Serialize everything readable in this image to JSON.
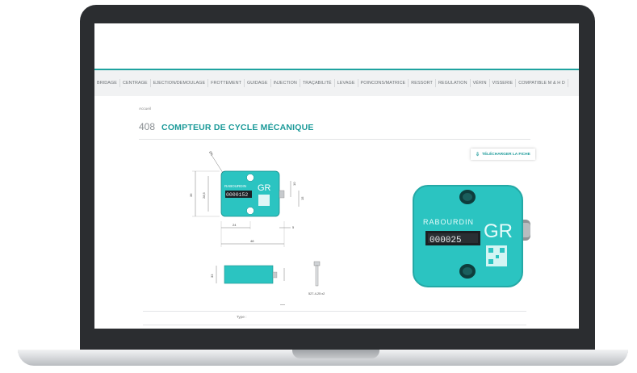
{
  "nav": {
    "items": [
      "BRIDAGE",
      "CENTRAGE",
      "EJECTION/DEMOULAGE",
      "FROTTEMENT",
      "GUIDAGE",
      "INJECTION",
      "TRAÇABILITÉ",
      "LEVAGE",
      "POINCONS/MATRICE",
      "RESSORT",
      "REGULATION",
      "VÉRIN",
      "VISSERIE",
      "COMPATIBLE M & H D"
    ]
  },
  "breadcrumb": "Accueil",
  "product": {
    "ref": "408",
    "title": "COMPTEUR DE CYCLE MÉCANIQUE",
    "download_label": "TÉLÉCHARGER LA FICHE"
  },
  "drawing": {
    "brand": "RABOURDIN",
    "counter": "0000152",
    "dim_39": "39",
    "dim_28_5": "28,5",
    "dim_24": "24",
    "dim_48": "48",
    "dim_10": "10",
    "dim_5": "5",
    "dim_33": "33",
    "dim_ang": "Ø6",
    "screw_label": "527-4-25 x2"
  },
  "photo": {
    "brand": "RABOURDIN",
    "counter": "000025"
  },
  "table": {
    "type_label": "Type :"
  },
  "colors": {
    "accent": "#1c9a99",
    "product": "#2bc4c1",
    "bezel": "#2b2d30"
  }
}
